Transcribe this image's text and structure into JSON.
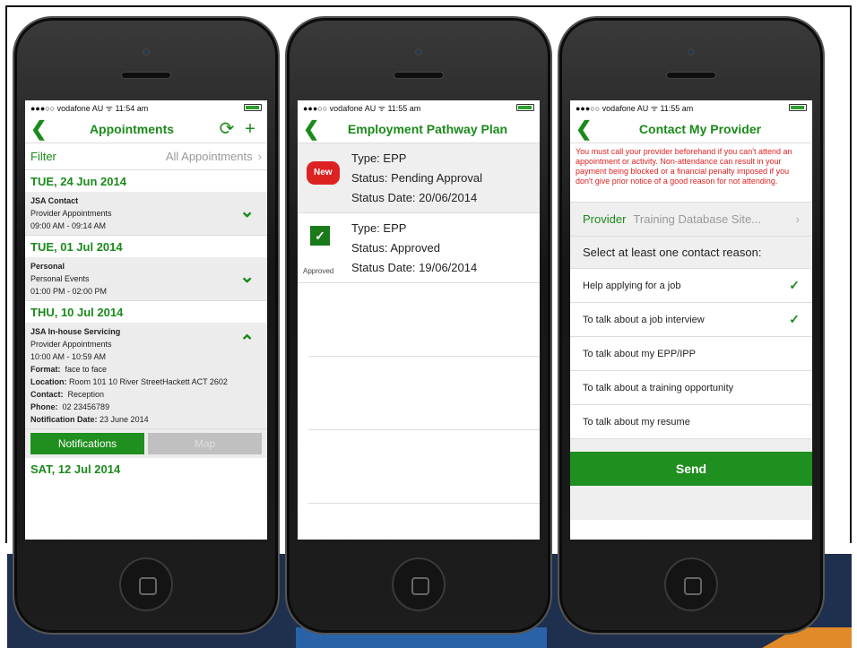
{
  "status": {
    "phone1": {
      "carrier": "●●●○○ vodafone AU ᯤ 11:54 am"
    },
    "phone2": {
      "carrier": "●●●○○ vodafone AU ᯤ 11:55 am"
    },
    "phone3": {
      "carrier": "●●●○○ vodafone AU ᯤ 11:55 am"
    }
  },
  "appointments": {
    "back": "❮",
    "title": "Appointments",
    "refresh": "⟳",
    "add": "+",
    "filter_label": "Filter",
    "filter_value": "All Appointments",
    "chevron": "›",
    "groups": [
      {
        "date": "TUE, 24 Jun 2014",
        "name": "JSA Contact",
        "type": "Provider Appointments",
        "time": "09:00 AM - 09:14 AM",
        "toggle": "⌄"
      },
      {
        "date": "TUE, 01 Jul 2014",
        "name": "Personal",
        "type": "Personal Events",
        "time": "01:00 PM - 02:00 PM",
        "toggle": "⌄"
      },
      {
        "date": "THU, 10 Jul 2014",
        "name": "JSA In-house Servicing",
        "type": "Provider Appointments",
        "time": "10:00 AM - 10:59 AM",
        "toggle": "⌃",
        "format_label": "Format:",
        "format": "face to face",
        "location_label": "Location:",
        "location": "Room 101 10 River StreetHackett ACT 2602",
        "contact_label": "Contact:",
        "contact": "Reception",
        "phone_label": "Phone:",
        "phone": "02 23456789",
        "notif_label": "Notification Date:",
        "notif": "23 June 2014"
      }
    ],
    "notifications_button": "Notifications",
    "map_button": "Map",
    "last_date": "SAT, 12 Jul 2014"
  },
  "epp": {
    "back": "❮",
    "title": "Employment Pathway Plan",
    "items": [
      {
        "badge": "New",
        "type": "Type:  EPP",
        "status": "Status:  Pending Approval",
        "date": "Status Date:  20/06/2014"
      },
      {
        "check": "✓",
        "badge_label": "Approved",
        "type": "Type:  EPP",
        "status": "Status:  Approved",
        "date": "Status Date:  19/06/2014"
      }
    ]
  },
  "contact": {
    "back": "❮",
    "title": "Contact My Provider",
    "warning": "You must call your provider beforehand if you can't attend an appointment or activity. Non-attendance can result in your payment being blocked or a financial penalty imposed if you don't give prior notice of a good reason for not attending.",
    "provider_label": "Provider",
    "provider_value": "Training Database Site...",
    "chevron": "›",
    "reason_heading": "Select at least one contact reason:",
    "reasons": [
      {
        "text": "Help applying for a job",
        "check": "✓"
      },
      {
        "text": "To talk about a job interview",
        "check": "✓"
      },
      {
        "text": "To talk about my EPP/IPP",
        "check": ""
      },
      {
        "text": "To talk about a training opportunity",
        "check": ""
      },
      {
        "text": "To talk about my resume",
        "check": ""
      }
    ],
    "send": "Send"
  },
  "colors": {
    "accent": "#1a8a1a",
    "warning": "#e02020",
    "badge": "#dd2222"
  }
}
